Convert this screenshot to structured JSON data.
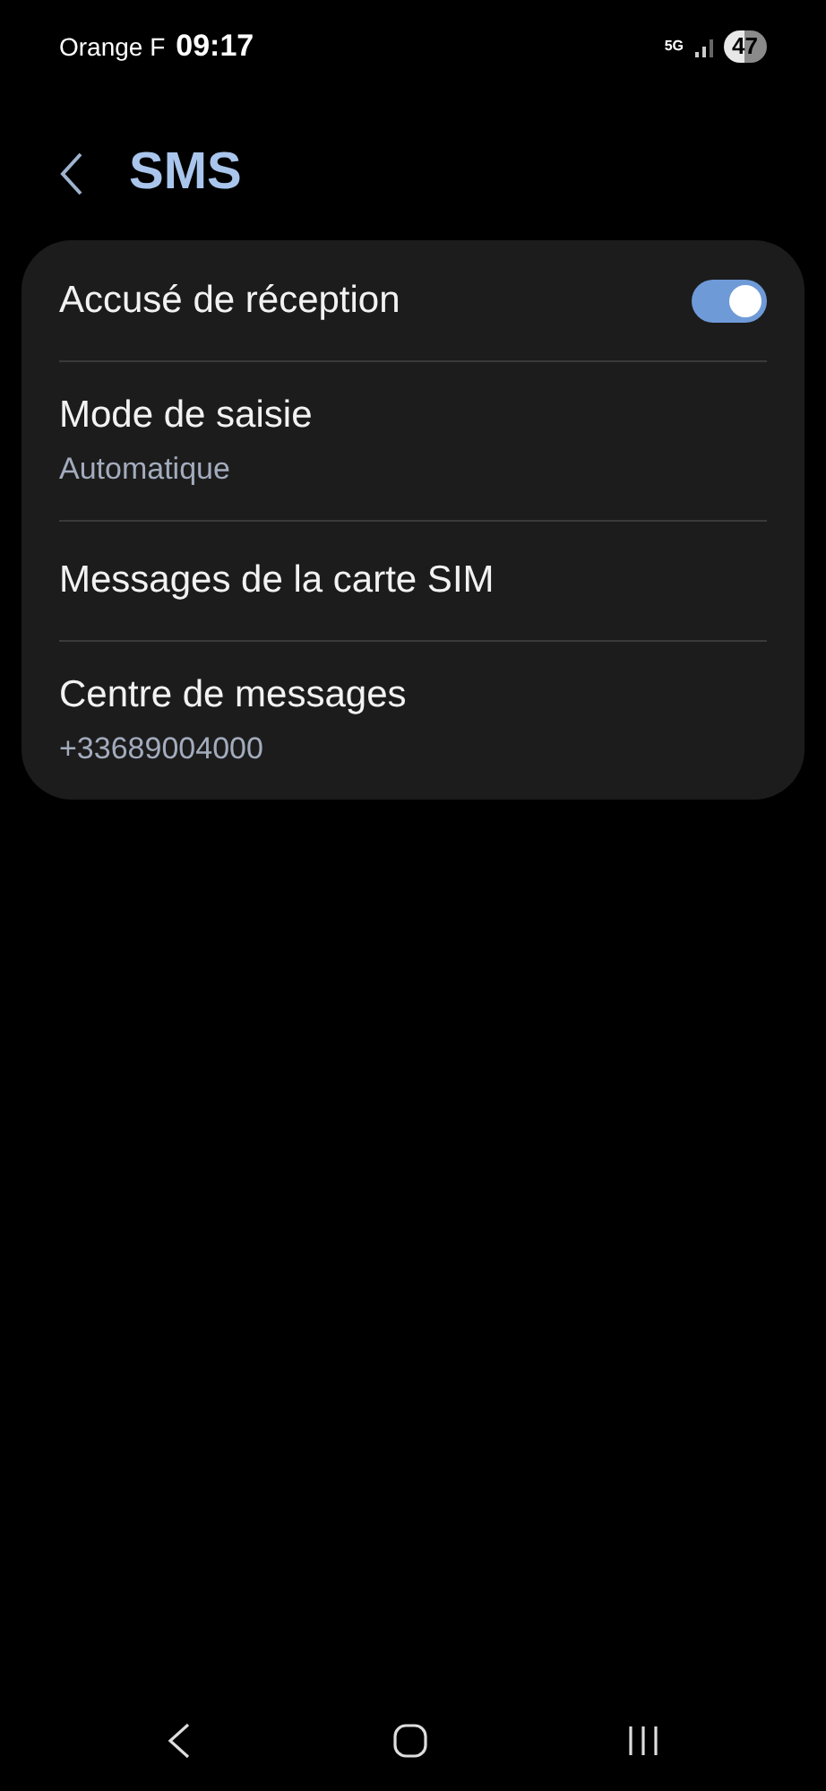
{
  "status_bar": {
    "carrier": "Orange F",
    "time": "09:17",
    "network": "5G",
    "battery": "47"
  },
  "header": {
    "title": "SMS"
  },
  "settings": [
    {
      "kind": "toggle",
      "label": "Accusé de réception",
      "on": true
    },
    {
      "kind": "subtitle",
      "label": "Mode de saisie",
      "value": "Automatique"
    },
    {
      "kind": "plain",
      "label": "Messages de la carte SIM"
    },
    {
      "kind": "subtitle",
      "label": "Centre de messages",
      "value": "+33689004000"
    }
  ]
}
